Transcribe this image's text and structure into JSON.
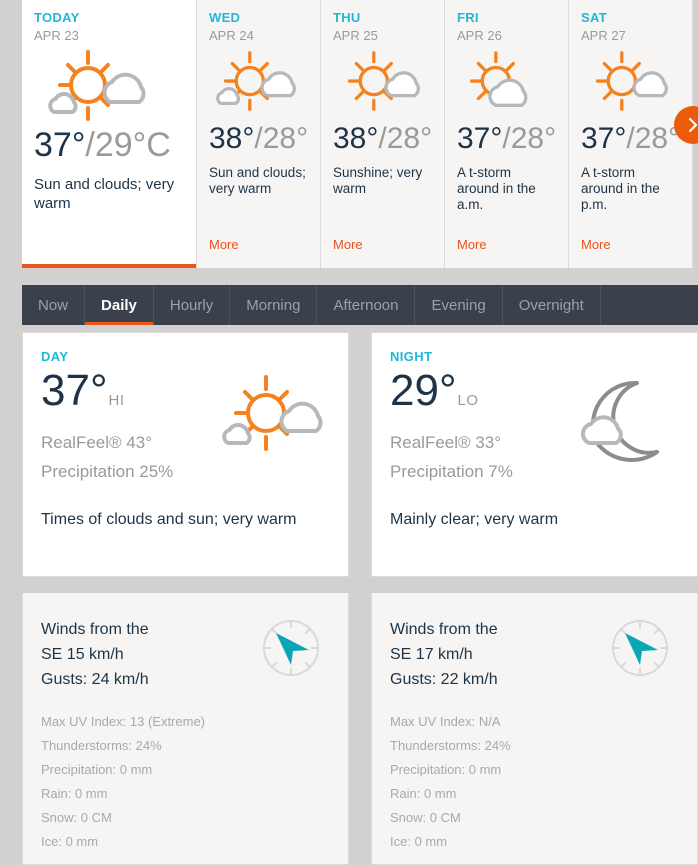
{
  "forecast": {
    "cards": [
      {
        "day": "TODAY",
        "date": "APR 23",
        "hi": "37°",
        "lo": "/29°C",
        "desc": "Sun and clouds; very warm",
        "icon": "sun-behind-cloud-icon",
        "more": "",
        "selected": true
      },
      {
        "day": "WED",
        "date": "APR 24",
        "hi": "38°",
        "lo": "/28°",
        "desc": "Sun and clouds; very warm",
        "icon": "sun-behind-cloud-icon",
        "more": "More",
        "selected": false
      },
      {
        "day": "THU",
        "date": "APR 25",
        "hi": "38°",
        "lo": "/28°",
        "desc": "Sunshine; very warm",
        "icon": "sun-behind-small-cloud-icon",
        "more": "More",
        "selected": false
      },
      {
        "day": "FRI",
        "date": "APR 26",
        "hi": "37°",
        "lo": "/28°",
        "desc": "A t-storm around in the a.m.",
        "icon": "sun-behind-cloud-icon",
        "more": "More",
        "selected": false
      },
      {
        "day": "SAT",
        "date": "APR 27",
        "hi": "37°",
        "lo": "/28°",
        "desc": "A t-storm around in the p.m.",
        "icon": "sun-behind-small-cloud-icon",
        "more": "More",
        "selected": false
      }
    ],
    "next_button": "next-arrow-icon"
  },
  "tabs": [
    {
      "label": "Now",
      "active": false
    },
    {
      "label": "Daily",
      "active": true
    },
    {
      "label": "Hourly",
      "active": false
    },
    {
      "label": "Morning",
      "active": false
    },
    {
      "label": "Afternoon",
      "active": false
    },
    {
      "label": "Evening",
      "active": false
    },
    {
      "label": "Overnight",
      "active": false
    }
  ],
  "day_panel": {
    "label": "DAY",
    "temp": "37°",
    "temp_suffix": "HI",
    "realfeel": "RealFeel® 43°",
    "precipitation": "Precipitation 25%",
    "description": "Times of clouds and sun; very warm",
    "icon": "sun-behind-cloud-icon",
    "wind_line1": "Winds from the",
    "wind_line2": "SE 15 km/h",
    "wind_line3": "Gusts: 24 km/h",
    "compass": "compass-se-icon",
    "details": [
      "Max UV Index: 13 (Extreme)",
      "Thunderstorms: 24%",
      "Precipitation: 0 mm",
      "Rain: 0 mm",
      "Snow: 0 CM",
      "Ice: 0 mm"
    ]
  },
  "night_panel": {
    "label": "NIGHT",
    "temp": "29°",
    "temp_suffix": "LO",
    "realfeel": "RealFeel® 33°",
    "precipitation": "Precipitation 7%",
    "description": "Mainly clear; very warm",
    "icon": "moon-behind-cloud-icon",
    "wind_line1": "Winds from the",
    "wind_line2": "SE 17 km/h",
    "wind_line3": "Gusts: 22 km/h",
    "compass": "compass-se-icon",
    "details": [
      "Max UV Index: N/A",
      "Thunderstorms: 24%",
      "Precipitation: 0 mm",
      "Rain: 0 mm",
      "Snow: 0 CM",
      "Ice: 0 mm"
    ]
  },
  "colors": {
    "accent_orange": "#e8541e",
    "accent_cyan": "#20b8d8",
    "navy": "#1d3448",
    "gray_text": "#9a9a9a",
    "tabbar_bg": "#3a414c",
    "page_bg": "#d3d0d0",
    "compass_arrow": "#0aa6b8"
  }
}
